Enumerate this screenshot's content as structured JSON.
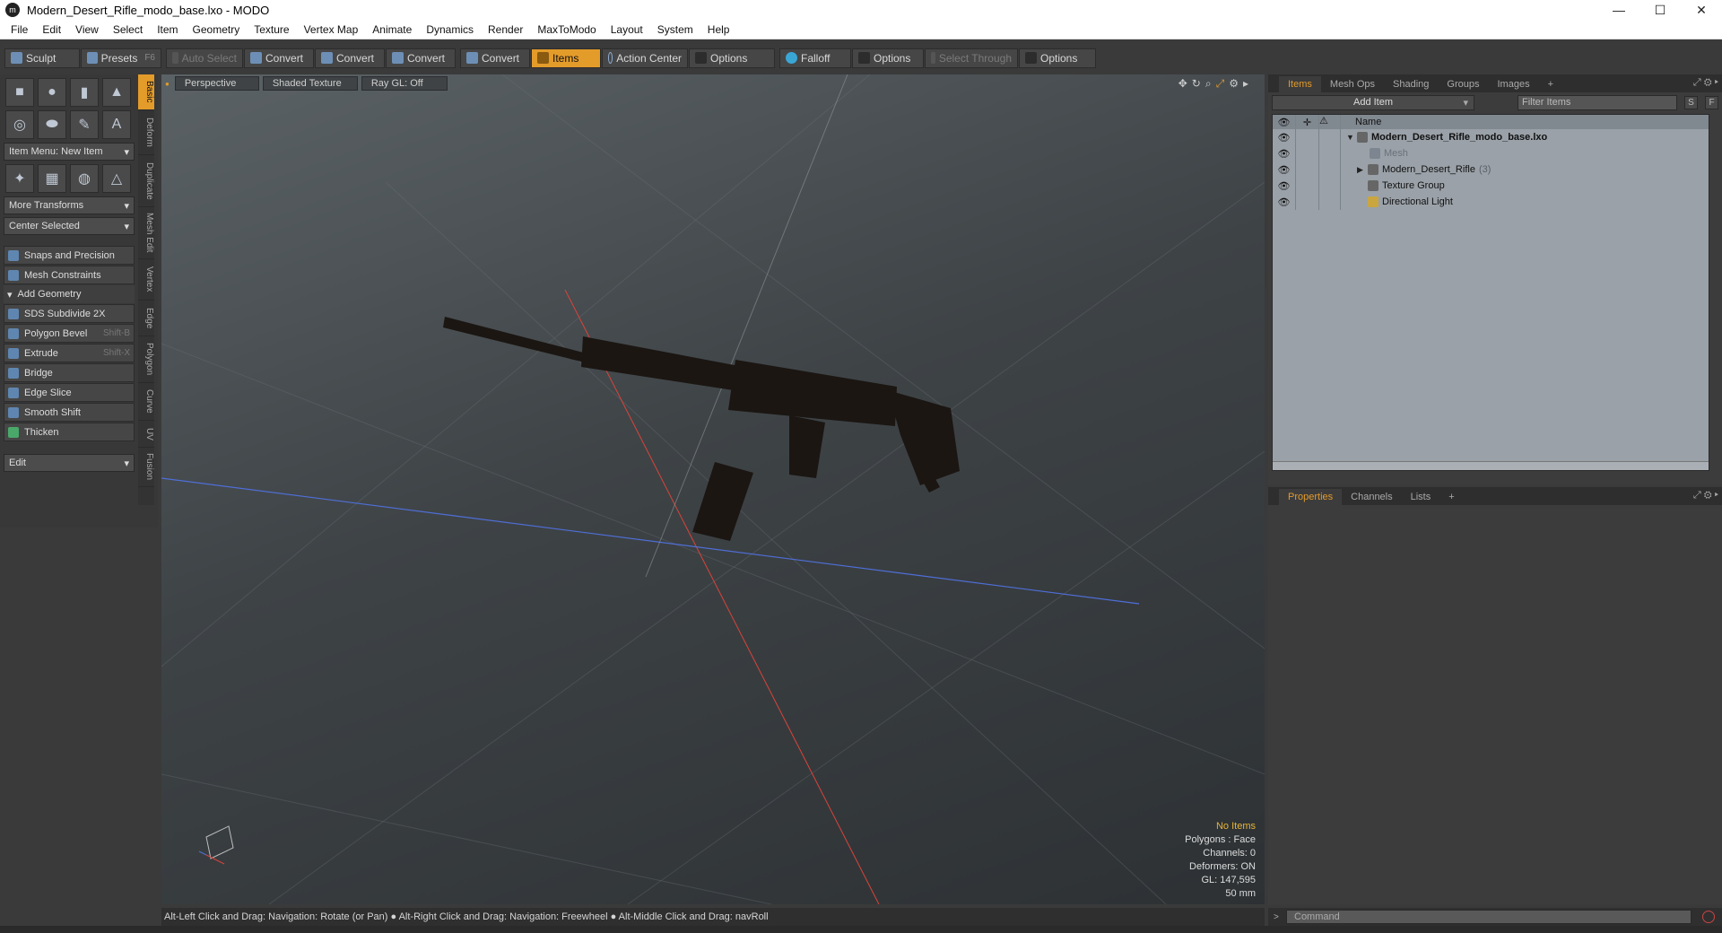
{
  "window": {
    "title": "Modern_Desert_Rifle_modo_base.lxo - MODO",
    "app_icon": "modo-logo-icon",
    "buttons": {
      "minimize": "—",
      "maximize": "☐",
      "close": "✕"
    }
  },
  "menu": [
    "File",
    "Edit",
    "View",
    "Select",
    "Item",
    "Geometry",
    "Texture",
    "Vertex Map",
    "Animate",
    "Dynamics",
    "Render",
    "MaxToModo",
    "Layout",
    "System",
    "Help"
  ],
  "toolbar": {
    "sculpt": "Sculpt",
    "presets": "Presets",
    "presets_shortcut": "F6",
    "auto_select": "Auto Select",
    "convert1": "Convert",
    "convert2": "Convert",
    "convert3": "Convert",
    "convert4": "Convert",
    "items": "Items",
    "action_center": "Action Center",
    "options1": "Options",
    "falloff": "Falloff",
    "options2": "Options",
    "select_through": "Select Through",
    "options3": "Options"
  },
  "left_panel": {
    "item_menu": "Item Menu: New Item",
    "more_transforms": "More Transforms",
    "center_selected": "Center Selected",
    "snaps": "Snaps and Precision",
    "mesh_constraints": "Mesh Constraints",
    "add_geometry": "Add Geometry",
    "tools": [
      {
        "label": "SDS Subdivide 2X",
        "shortcut": ""
      },
      {
        "label": "Polygon Bevel",
        "shortcut": "Shift-B"
      },
      {
        "label": "Extrude",
        "shortcut": "Shift-X"
      },
      {
        "label": "Bridge",
        "shortcut": ""
      },
      {
        "label": "Edge Slice",
        "shortcut": ""
      },
      {
        "label": "Smooth Shift",
        "shortcut": ""
      },
      {
        "label": "Thicken",
        "shortcut": ""
      }
    ],
    "edit": "Edit",
    "vertical_tabs": [
      "Basic",
      "Deform",
      "Duplicate",
      "Mesh Edit",
      "Vertex",
      "Edge",
      "Polygon",
      "Curve",
      "UV",
      "Fusion"
    ]
  },
  "viewport": {
    "view": "Perspective",
    "shading": "Shaded Texture",
    "raygl": "Ray GL: Off",
    "info": {
      "no_items": "No Items",
      "polygons": "Polygons : Face",
      "channels": "Channels: 0",
      "deformers": "Deformers: ON",
      "gl": "GL: 147,595",
      "scale": "50 mm"
    }
  },
  "status": "Alt-Left Click and Drag: Navigation: Rotate (or Pan) ● Alt-Right Click and Drag: Navigation: Freewheel ● Alt-Middle Click and Drag: navRoll",
  "items_panel": {
    "tabs": [
      "Items",
      "Mesh Ops",
      "Shading",
      "Groups",
      "Images",
      "+"
    ],
    "add_item": "Add Item",
    "filter_placeholder": "Filter Items",
    "s_btn": "S",
    "f_btn": "F",
    "name_header": "Name",
    "rows": [
      {
        "name": "Modern_Desert_Rifle_modo_base.lxo",
        "count": ""
      },
      {
        "name": "Mesh",
        "count": ""
      },
      {
        "name": "Modern_Desert_Rifle",
        "count": "(3)"
      },
      {
        "name": "Texture Group",
        "count": ""
      },
      {
        "name": "Directional Light",
        "count": ""
      }
    ]
  },
  "properties_panel": {
    "tabs": [
      "Properties",
      "Channels",
      "Lists",
      "+"
    ]
  },
  "command": {
    "placeholder": "Command"
  },
  "colors": {
    "accent": "#e39b2a",
    "x_axis": "#d9443a",
    "z_axis": "#4f6fd8"
  }
}
